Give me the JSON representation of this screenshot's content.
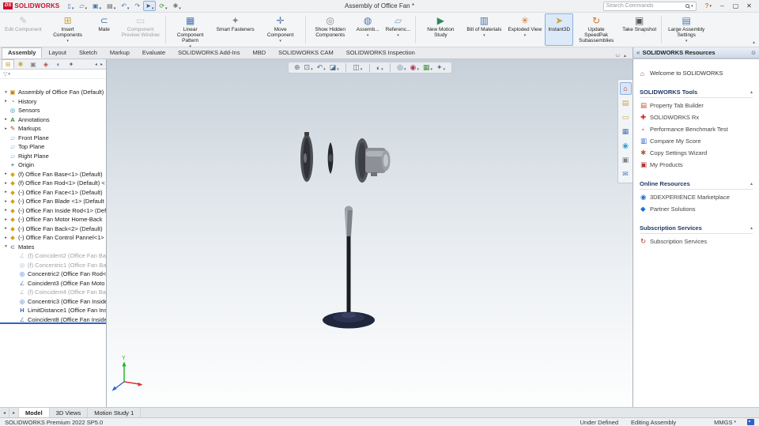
{
  "colors": {
    "accent_blue": "#2d63c8",
    "brand_red": "#c8102e",
    "ribbon_active_bg": "#dce9f8",
    "viewport_gradient_top": "#c7d0d9",
    "selection_underline": "#2d63c8"
  },
  "titlebar": {
    "brand_ds": "DS",
    "brand": "SOLIDWORKS",
    "title": "Assembly of Office Fan *",
    "search_placeholder": "Search Commands",
    "search_dropdown": "▾",
    "help": "?",
    "help_dropdown": "▾",
    "minimize": "–",
    "maximize": "▢",
    "close": "✕",
    "quick_icons": [
      {
        "icon": "new-document-icon",
        "glyph": "▯",
        "drop": "has",
        "cls": ""
      },
      {
        "icon": "open-icon",
        "glyph": "▱",
        "drop": "has",
        "cls": ""
      },
      {
        "icon": "save-icon",
        "glyph": "▣",
        "drop": "has",
        "cls": ""
      },
      {
        "icon": "print-icon",
        "glyph": "▤",
        "drop": "has",
        "cls": ""
      },
      {
        "icon": "undo-icon",
        "glyph": "↶",
        "drop": "has",
        "cls": ""
      },
      {
        "icon": "redo-icon",
        "glyph": "↷",
        "drop": "",
        "cls": ""
      },
      {
        "icon": "select-icon",
        "glyph": "➤",
        "drop": "has",
        "cls": "active"
      },
      {
        "icon": "rebuild-icon",
        "glyph": "⟳",
        "drop": "has",
        "cls": ""
      },
      {
        "icon": "options-icon",
        "glyph": "✱",
        "drop": "has",
        "cls": ""
      }
    ]
  },
  "ribbon": {
    "collapse": "▴",
    "buttons": [
      {
        "name": "ribbon-button",
        "cls": "btn disabled",
        "icon": "edit-component-icon",
        "glyph": "✎",
        "label": "Edit Component",
        "drop": ""
      },
      {
        "name": "ribbon-button",
        "cls": "btn",
        "icon": "insert-components-icon",
        "glyph": "⊞",
        "label": "Insert Components",
        "drop": "has"
      },
      {
        "name": "ribbon-button",
        "cls": "btn",
        "icon": "mate-command-icon",
        "glyph": "⊂",
        "label": "Mate",
        "drop": ""
      },
      {
        "name": "ribbon-button",
        "cls": "btn disabled",
        "icon": "component-preview-icon",
        "glyph": "▭",
        "label": "Component Preview Window",
        "drop": ""
      },
      {
        "name": "ribbon-separator",
        "cls": "sep",
        "icon": "separator",
        "glyph": "",
        "label": "",
        "drop": ""
      },
      {
        "name": "ribbon-button",
        "cls": "btn",
        "icon": "linear-pattern-icon",
        "glyph": "▦",
        "label": "Linear Component Pattern",
        "drop": "has"
      },
      {
        "name": "ribbon-button",
        "cls": "btn",
        "icon": "smart-fasteners-icon",
        "glyph": "✦",
        "label": "Smart Fasteners",
        "drop": ""
      },
      {
        "name": "ribbon-button",
        "cls": "btn",
        "icon": "move-component-icon",
        "glyph": "✛",
        "label": "Move Component",
        "drop": "has"
      },
      {
        "name": "ribbon-separator",
        "cls": "sep",
        "icon": "separator",
        "glyph": "",
        "label": "",
        "drop": ""
      },
      {
        "name": "ribbon-button",
        "cls": "btn",
        "icon": "show-hidden-icon",
        "glyph": "◎",
        "label": "Show Hidden Components",
        "drop": ""
      },
      {
        "name": "ribbon-button",
        "cls": "btn",
        "icon": "assembly-features-icon",
        "glyph": "◍",
        "label": "Assemb...",
        "drop": "has"
      },
      {
        "name": "ribbon-button",
        "cls": "btn",
        "icon": "reference-geometry-icon",
        "glyph": "▱",
        "label": "Referenc...",
        "drop": "has"
      },
      {
        "name": "ribbon-separator",
        "cls": "sep",
        "icon": "separator",
        "glyph": "",
        "label": "",
        "drop": ""
      },
      {
        "name": "ribbon-button",
        "cls": "btn",
        "icon": "new-motion-study-icon",
        "glyph": "▶",
        "label": "New Motion Study",
        "drop": ""
      },
      {
        "name": "ribbon-button",
        "cls": "btn",
        "icon": "bill-of-materials-icon",
        "glyph": "▥",
        "label": "Bill of Materials",
        "drop": "has"
      },
      {
        "name": "ribbon-button",
        "cls": "btn",
        "icon": "exploded-view-icon",
        "glyph": "✳",
        "label": "Exploded View",
        "drop": "has"
      },
      {
        "name": "ribbon-button",
        "cls": "btn active",
        "icon": "instant3d-icon",
        "glyph": "➤",
        "label": "Instant3D",
        "drop": ""
      },
      {
        "name": "ribbon-button",
        "cls": "btn",
        "icon": "update-speedpak-icon",
        "glyph": "↻",
        "label": "Update SpeedPak Subassemblies",
        "drop": ""
      },
      {
        "name": "ribbon-button",
        "cls": "btn",
        "icon": "take-snapshot-icon",
        "glyph": "▣",
        "label": "Take Snapshot",
        "drop": ""
      },
      {
        "name": "ribbon-separator",
        "cls": "sep",
        "icon": "separator",
        "glyph": "",
        "label": "",
        "drop": ""
      },
      {
        "name": "ribbon-button",
        "cls": "btn",
        "icon": "large-assembly-settings-icon",
        "glyph": "▤",
        "label": "Large Assembly Settings",
        "drop": "has"
      }
    ]
  },
  "tabs": {
    "float_icon": "▭",
    "collapse_icon": "▴",
    "items": [
      {
        "label": "Assembly",
        "cls": "active"
      },
      {
        "label": "Layout",
        "cls": ""
      },
      {
        "label": "Sketch",
        "cls": ""
      },
      {
        "label": "Markup",
        "cls": ""
      },
      {
        "label": "Evaluate",
        "cls": ""
      },
      {
        "label": "SOLIDWORKS Add-Ins",
        "cls": ""
      },
      {
        "label": "MBD",
        "cls": ""
      },
      {
        "label": "SOLIDWORKS CAM",
        "cls": ""
      },
      {
        "label": "SOLIDWORKS Inspection",
        "cls": ""
      }
    ]
  },
  "tree": {
    "nav_left": "◂",
    "nav_right": "▸",
    "filter_icon": "▽",
    "filter_drop": "▾",
    "manager_tabs": [
      {
        "icon": "featuremanager-tab-icon",
        "glyph": "⊞",
        "cls": "active"
      },
      {
        "icon": "propertymanager-tab-icon",
        "glyph": "✱",
        "cls": ""
      },
      {
        "icon": "configurationmanager-tab-icon",
        "glyph": "▣",
        "cls": ""
      },
      {
        "icon": "dimxpertmanager-tab-icon",
        "glyph": "◈",
        "cls": ""
      },
      {
        "icon": "displaymanager-tab-icon",
        "glyph": "◐",
        "cls": ""
      },
      {
        "icon": "cam-tab-icon",
        "glyph": "✦",
        "cls": ""
      }
    ],
    "items": [
      {
        "icon": "assembly-icon",
        "glyph": "▣",
        "arrow": "▾",
        "label": "Assembly of Office Fan (Default)",
        "cls": ""
      },
      {
        "icon": "history-icon",
        "glyph": "◔",
        "arrow": "▸",
        "label": "History",
        "cls": ""
      },
      {
        "icon": "sensors-icon",
        "glyph": "◎",
        "arrow": "",
        "label": "Sensors",
        "cls": ""
      },
      {
        "icon": "annotations-icon",
        "glyph": "A",
        "arrow": "▸",
        "label": "Annotations",
        "cls": ""
      },
      {
        "icon": "markups-icon",
        "glyph": "✎",
        "arrow": "▸",
        "label": "Markups",
        "cls": ""
      },
      {
        "icon": "plane-icon",
        "glyph": "▱",
        "arrow": "",
        "label": "Front Plane",
        "cls": ""
      },
      {
        "icon": "plane-icon",
        "glyph": "▱",
        "arrow": "",
        "label": "Top Plane",
        "cls": ""
      },
      {
        "icon": "plane-icon",
        "glyph": "▱",
        "arrow": "",
        "label": "Right Plane",
        "cls": ""
      },
      {
        "icon": "origin-icon",
        "glyph": "+",
        "arrow": "",
        "label": "Origin",
        "cls": ""
      },
      {
        "icon": "part-icon",
        "glyph": "◆",
        "arrow": "▸",
        "label": "(f) Office Fan Base<1> (Default)",
        "cls": ""
      },
      {
        "icon": "part-icon",
        "glyph": "◆",
        "arrow": "▸",
        "label": "(f) Office Fan Rod<1> (Default) <",
        "cls": ""
      },
      {
        "icon": "part-icon",
        "glyph": "◆",
        "arrow": "▸",
        "label": "(-) Office Fan Face<1> (Default)",
        "cls": ""
      },
      {
        "icon": "part-icon",
        "glyph": "◆",
        "arrow": "▸",
        "label": "(-) Office Fan Blade <1> (Default",
        "cls": ""
      },
      {
        "icon": "part-icon",
        "glyph": "◆",
        "arrow": "▸",
        "label": "(-) Office Fan Inside Rod<1> (Def",
        "cls": ""
      },
      {
        "icon": "part-icon",
        "glyph": "◆",
        "arrow": "▸",
        "label": "(-) Office Fan Motor Home-Back",
        "cls": ""
      },
      {
        "icon": "part-icon",
        "glyph": "◆",
        "arrow": "▸",
        "label": "(-) Office Fan Back<2> (Default)",
        "cls": ""
      },
      {
        "icon": "part-icon",
        "glyph": "◆",
        "arrow": "▸",
        "label": "(-) Office Fan Control Pannel<1>",
        "cls": ""
      },
      {
        "icon": "mates-folder-icon",
        "glyph": "⊂",
        "arrow": "▾",
        "label": "Mates",
        "cls": ""
      },
      {
        "icon": "coincident-mate-icon",
        "glyph": "∠",
        "arrow": "",
        "label": "(f) Coincident2 (Office Fan Ba",
        "cls": "child gray"
      },
      {
        "icon": "concentric-mate-icon",
        "glyph": "◎",
        "arrow": "",
        "label": "(f) Concentric1 (Office Fan Ba",
        "cls": "child gray"
      },
      {
        "icon": "concentric-mate-icon",
        "glyph": "◎",
        "arrow": "",
        "label": "Concentric2 (Office Fan Rod<",
        "cls": "child"
      },
      {
        "icon": "coincident-mate-icon",
        "glyph": "∠",
        "arrow": "",
        "label": "Coincident3 (Office Fan Moto",
        "cls": "child"
      },
      {
        "icon": "coincident-mate-icon",
        "glyph": "∠",
        "arrow": "",
        "label": "(f) Coincident4 (Office Fan Ba",
        "cls": "child gray"
      },
      {
        "icon": "concentric-mate-icon",
        "glyph": "◎",
        "arrow": "",
        "label": "Concentric3 (Office Fan Inside",
        "cls": "child"
      },
      {
        "icon": "limit-distance-mate-icon",
        "glyph": "H",
        "arrow": "",
        "label": "LimitDistance1 (Office Fan Ins",
        "cls": "child"
      },
      {
        "icon": "coincident-mate-icon",
        "glyph": "∠",
        "arrow": "",
        "label": "Coincident8 (Office Fan Inside",
        "cls": "child sel"
      }
    ]
  },
  "viewport": {
    "triad_y": "Y",
    "headsup": [
      {
        "icon": "zoom-to-fit-icon",
        "glyph": "⊕",
        "drop": "",
        "cls": ""
      },
      {
        "icon": "zoom-to-area-icon",
        "glyph": "⊡",
        "drop": "has",
        "cls": ""
      },
      {
        "icon": "previous-view-icon",
        "glyph": "↶",
        "drop": "has",
        "cls": ""
      },
      {
        "icon": "section-view-icon",
        "glyph": "◪",
        "drop": "has",
        "cls": ""
      },
      {
        "icon": "view-orientation-icon",
        "glyph": "◫",
        "drop": "has",
        "cls": "gap"
      },
      {
        "icon": "display-style-icon",
        "glyph": "◐",
        "drop": "has",
        "cls": "gap"
      },
      {
        "icon": "hide-show-items-icon",
        "glyph": "◎",
        "drop": "has",
        "cls": "gap"
      },
      {
        "icon": "edit-appearance-icon",
        "glyph": "◉",
        "drop": "has",
        "cls": ""
      },
      {
        "icon": "apply-scene-icon",
        "glyph": "▦",
        "drop": "has",
        "cls": ""
      },
      {
        "icon": "view-settings-icon",
        "glyph": "✦",
        "drop": "has",
        "cls": ""
      }
    ],
    "strip": [
      {
        "icon": "solidworks-resources-tab-icon",
        "glyph": "⌂",
        "cls": "active"
      },
      {
        "icon": "design-library-tab-icon",
        "glyph": "▤",
        "cls": ""
      },
      {
        "icon": "file-explorer-tab-icon",
        "glyph": "▭",
        "cls": ""
      },
      {
        "icon": "view-palette-tab-icon",
        "glyph": "▦",
        "cls": ""
      },
      {
        "icon": "appearances-scenes-tab-icon",
        "glyph": "◉",
        "cls": ""
      },
      {
        "icon": "custom-properties-tab-icon",
        "glyph": "▣",
        "cls": ""
      },
      {
        "icon": "forum-tab-icon",
        "glyph": "✉",
        "cls": ""
      }
    ]
  },
  "taskpane": {
    "chevrons": "«",
    "title": "SOLIDWORKS Resources",
    "pin": "⊙",
    "rows": [
      {
        "type": "welcome",
        "icon": "welcome-home-icon",
        "glyph": "⌂",
        "label": "Welcome to SOLIDWORKS",
        "arrow": ""
      },
      {
        "type": "header",
        "icon": "",
        "glyph": "",
        "label": "SOLIDWORKS Tools",
        "arrow": "▴"
      },
      {
        "type": "link",
        "icon": "property-tab-builder-icon",
        "glyph": "▤",
        "label": "Property Tab Builder",
        "arrow": ""
      },
      {
        "type": "link",
        "icon": "solidworks-rx-icon",
        "glyph": "✚",
        "label": "SOLIDWORKS Rx",
        "arrow": ""
      },
      {
        "type": "link",
        "icon": "performance-benchmark-icon",
        "glyph": "◔",
        "label": "Performance Benchmark Test",
        "arrow": ""
      },
      {
        "type": "link",
        "icon": "compare-my-score-icon",
        "glyph": "▥",
        "label": "Compare My Score",
        "arrow": ""
      },
      {
        "type": "link",
        "icon": "copy-settings-wizard-icon",
        "glyph": "✱",
        "label": "Copy Settings Wizard",
        "arrow": ""
      },
      {
        "type": "link",
        "icon": "my-products-icon",
        "glyph": "▣",
        "label": "My Products",
        "arrow": ""
      },
      {
        "type": "header",
        "icon": "",
        "glyph": "",
        "label": "Online Resources",
        "arrow": "▴"
      },
      {
        "type": "link",
        "icon": "3dexperience-marketplace-icon",
        "glyph": "◉",
        "label": "3DEXPERIENCE Marketplace",
        "arrow": ""
      },
      {
        "type": "link",
        "icon": "partner-solutions-icon",
        "glyph": "◆",
        "label": "Partner Solutions",
        "arrow": ""
      },
      {
        "type": "header",
        "icon": "",
        "glyph": "",
        "label": "Subscription Services",
        "arrow": "▴"
      },
      {
        "type": "link",
        "icon": "subscription-services-icon",
        "glyph": "↻",
        "label": "Subscription Services",
        "arrow": ""
      }
    ]
  },
  "bottom": {
    "nav_left": "◂",
    "nav_right": "▸",
    "tabs": [
      {
        "label": "Model",
        "cls": "active"
      },
      {
        "label": "3D Views",
        "cls": ""
      },
      {
        "label": "Motion Study 1",
        "cls": ""
      }
    ]
  },
  "status": {
    "left": "SOLIDWORKS Premium 2022 SP5.0",
    "define_state": "Under Defined",
    "mode": "Editing Assembly",
    "units": "MMGS",
    "units_drop": "▾"
  }
}
